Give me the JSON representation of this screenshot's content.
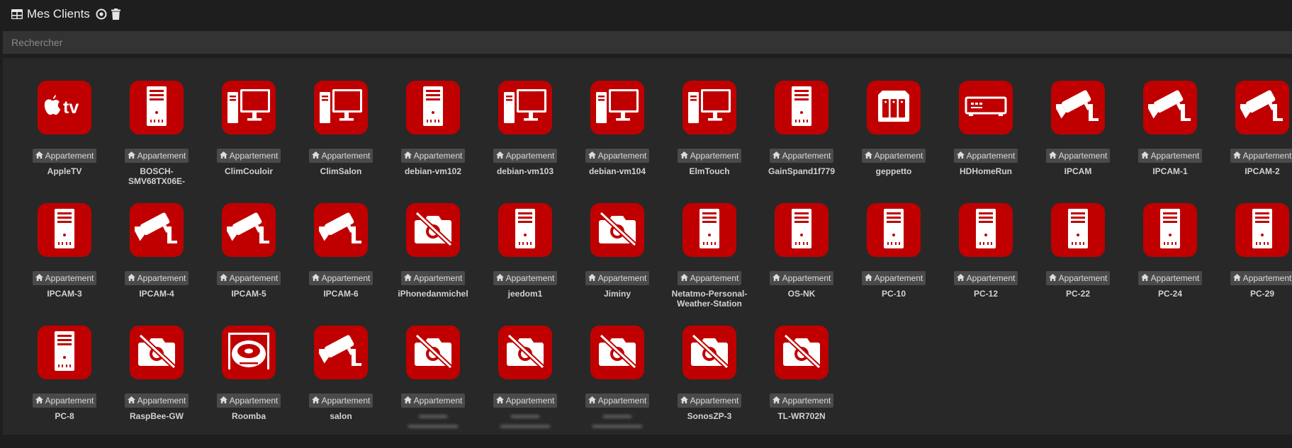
{
  "header": {
    "title": "Mes Clients"
  },
  "search": {
    "placeholder": "Rechercher"
  },
  "colors": {
    "tile": "#c00000",
    "badge": "#4a4a4a",
    "panel": "#282828"
  },
  "clients": [
    {
      "name": "AppleTV",
      "location": "Appartement",
      "icon": "appletv-icon"
    },
    {
      "name": "BOSCH-SMV68TX06E-",
      "location": "Appartement",
      "icon": "server-tower-icon"
    },
    {
      "name": "ClimCouloir",
      "location": "Appartement",
      "icon": "desktop-computer-icon"
    },
    {
      "name": "ClimSalon",
      "location": "Appartement",
      "icon": "desktop-computer-icon"
    },
    {
      "name": "debian-vm102",
      "location": "Appartement",
      "icon": "server-tower-icon"
    },
    {
      "name": "debian-vm103",
      "location": "Appartement",
      "icon": "desktop-computer-icon"
    },
    {
      "name": "debian-vm104",
      "location": "Appartement",
      "icon": "desktop-computer-icon"
    },
    {
      "name": "ElmTouch",
      "location": "Appartement",
      "icon": "desktop-computer-icon"
    },
    {
      "name": "GainSpand1f779",
      "location": "Appartement",
      "icon": "server-tower-icon"
    },
    {
      "name": "geppetto",
      "location": "Appartement",
      "icon": "nas-icon"
    },
    {
      "name": "HDHomeRun",
      "location": "Appartement",
      "icon": "set-top-box-icon"
    },
    {
      "name": "IPCAM",
      "location": "Appartement",
      "icon": "security-camera-icon"
    },
    {
      "name": "IPCAM-1",
      "location": "Appartement",
      "icon": "security-camera-icon"
    },
    {
      "name": "IPCAM-2",
      "location": "Appartement",
      "icon": "security-camera-icon"
    },
    {
      "name": "IPCAM-3",
      "location": "Appartement",
      "icon": "server-tower-icon"
    },
    {
      "name": "IPCAM-4",
      "location": "Appartement",
      "icon": "security-camera-icon"
    },
    {
      "name": "IPCAM-5",
      "location": "Appartement",
      "icon": "security-camera-icon"
    },
    {
      "name": "IPCAM-6",
      "location": "Appartement",
      "icon": "security-camera-icon"
    },
    {
      "name": "iPhonedanmichel",
      "location": "Appartement",
      "icon": "camera-off-icon"
    },
    {
      "name": "jeedom1",
      "location": "Appartement",
      "icon": "server-tower-icon"
    },
    {
      "name": "Jiminy",
      "location": "Appartement",
      "icon": "camera-off-icon"
    },
    {
      "name": "Netatmo-Personal-Weather-Station",
      "location": "Appartement",
      "icon": "server-tower-icon"
    },
    {
      "name": "OS-NK",
      "location": "Appartement",
      "icon": "server-tower-icon"
    },
    {
      "name": "PC-10",
      "location": "Appartement",
      "icon": "server-tower-icon"
    },
    {
      "name": "PC-12",
      "location": "Appartement",
      "icon": "server-tower-icon"
    },
    {
      "name": "PC-22",
      "location": "Appartement",
      "icon": "server-tower-icon"
    },
    {
      "name": "PC-24",
      "location": "Appartement",
      "icon": "server-tower-icon"
    },
    {
      "name": "PC-29",
      "location": "Appartement",
      "icon": "server-tower-icon"
    },
    {
      "name": "PC-8",
      "location": "Appartement",
      "icon": "server-tower-icon"
    },
    {
      "name": "RaspBee-GW",
      "location": "Appartement",
      "icon": "camera-off-icon"
    },
    {
      "name": "Roomba",
      "location": "Appartement",
      "icon": "robot-vacuum-icon"
    },
    {
      "name": "salon",
      "location": "Appartement",
      "icon": "security-camera-icon"
    },
    {
      "name": "",
      "location": "Appartement",
      "icon": "camera-off-icon",
      "blurred": true
    },
    {
      "name": "",
      "location": "Appartement",
      "icon": "camera-off-icon",
      "blurred": true
    },
    {
      "name": "",
      "location": "Appartement",
      "icon": "camera-off-icon",
      "blurred": true
    },
    {
      "name": "SonosZP-3",
      "location": "Appartement",
      "icon": "camera-off-icon"
    },
    {
      "name": "TL-WR702N",
      "location": "Appartement",
      "icon": "camera-off-icon"
    }
  ]
}
